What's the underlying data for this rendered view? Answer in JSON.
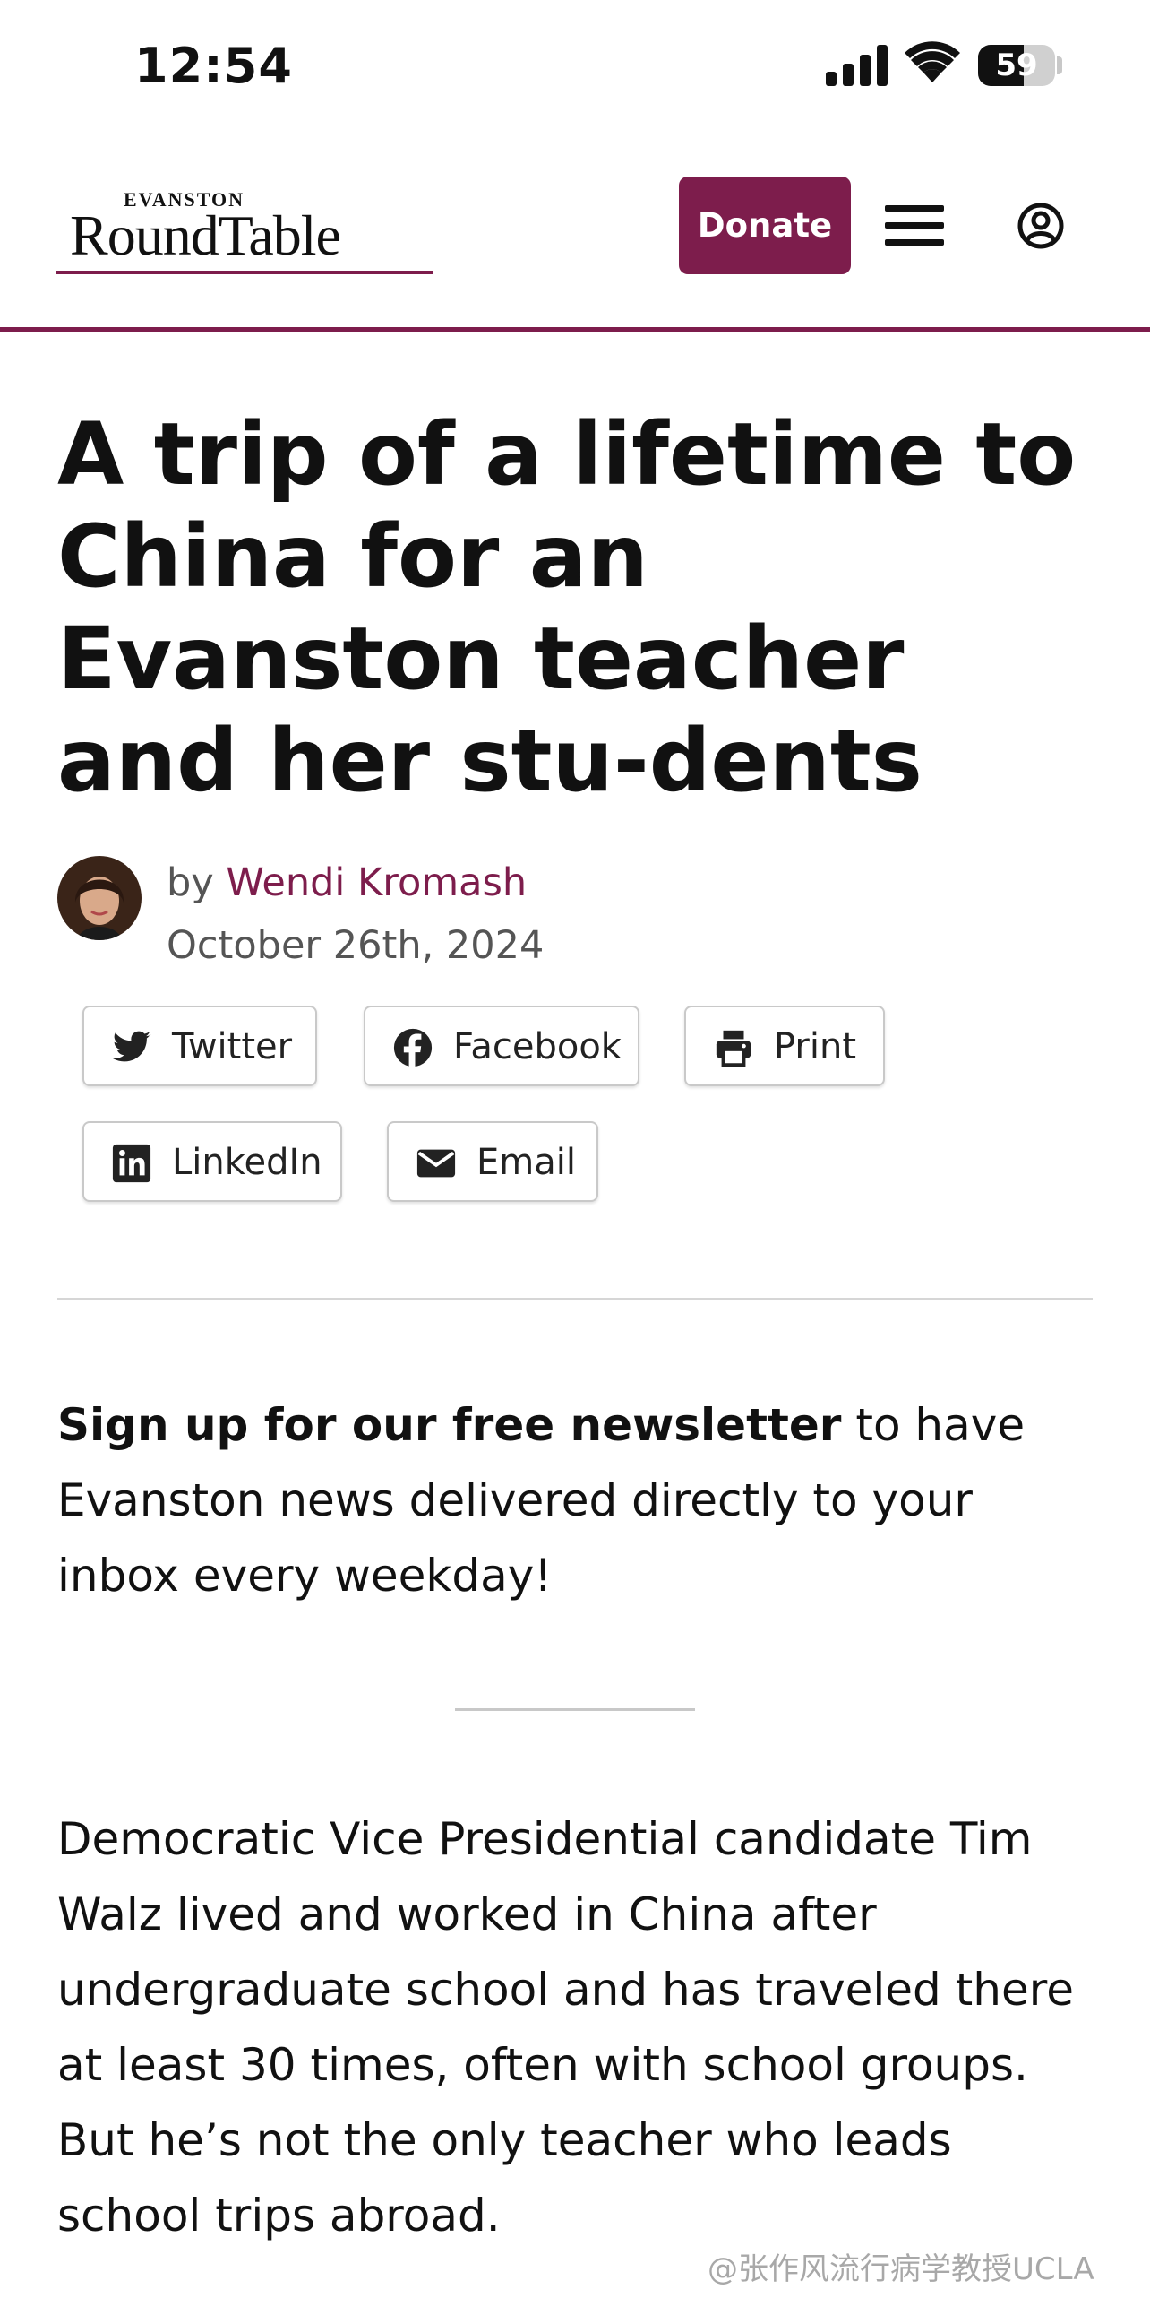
{
  "status_bar": {
    "time": "12:54",
    "battery": "59",
    "battery_level": 0.59
  },
  "header": {
    "logo_small": "EVANSTON",
    "logo_big": "RoundTable",
    "donate_label": "Donate",
    "accent_color": "#7d1d4c"
  },
  "article": {
    "headline": "A trip of a lifetime to China for an Evanston teacher and her stu-dents",
    "by_prefix": "by",
    "author": "Wendi Kromash",
    "date": "October 26th, 2024"
  },
  "share_buttons": [
    {
      "label": "Twitter",
      "icon": "twitter-icon"
    },
    {
      "label": "Facebook",
      "icon": "facebook-icon"
    },
    {
      "label": "Print",
      "icon": "print-icon"
    },
    {
      "label": "LinkedIn",
      "icon": "linkedin-icon"
    },
    {
      "label": "Email",
      "icon": "email-icon"
    }
  ],
  "newsletter": {
    "bold": "Sign up for our free newsletter",
    "rest": " to have Evanston news delivered directly to your inbox every weekday!"
  },
  "body": {
    "paragraph_1": "Democratic Vice Presidential candidate Tim Walz lived and worked in China after undergraduate school and has traveled there at least 30 times, often with school groups. But he’s not the only teacher who leads school trips abroad."
  },
  "watermark": "@张作风流行病学教授UCLA"
}
